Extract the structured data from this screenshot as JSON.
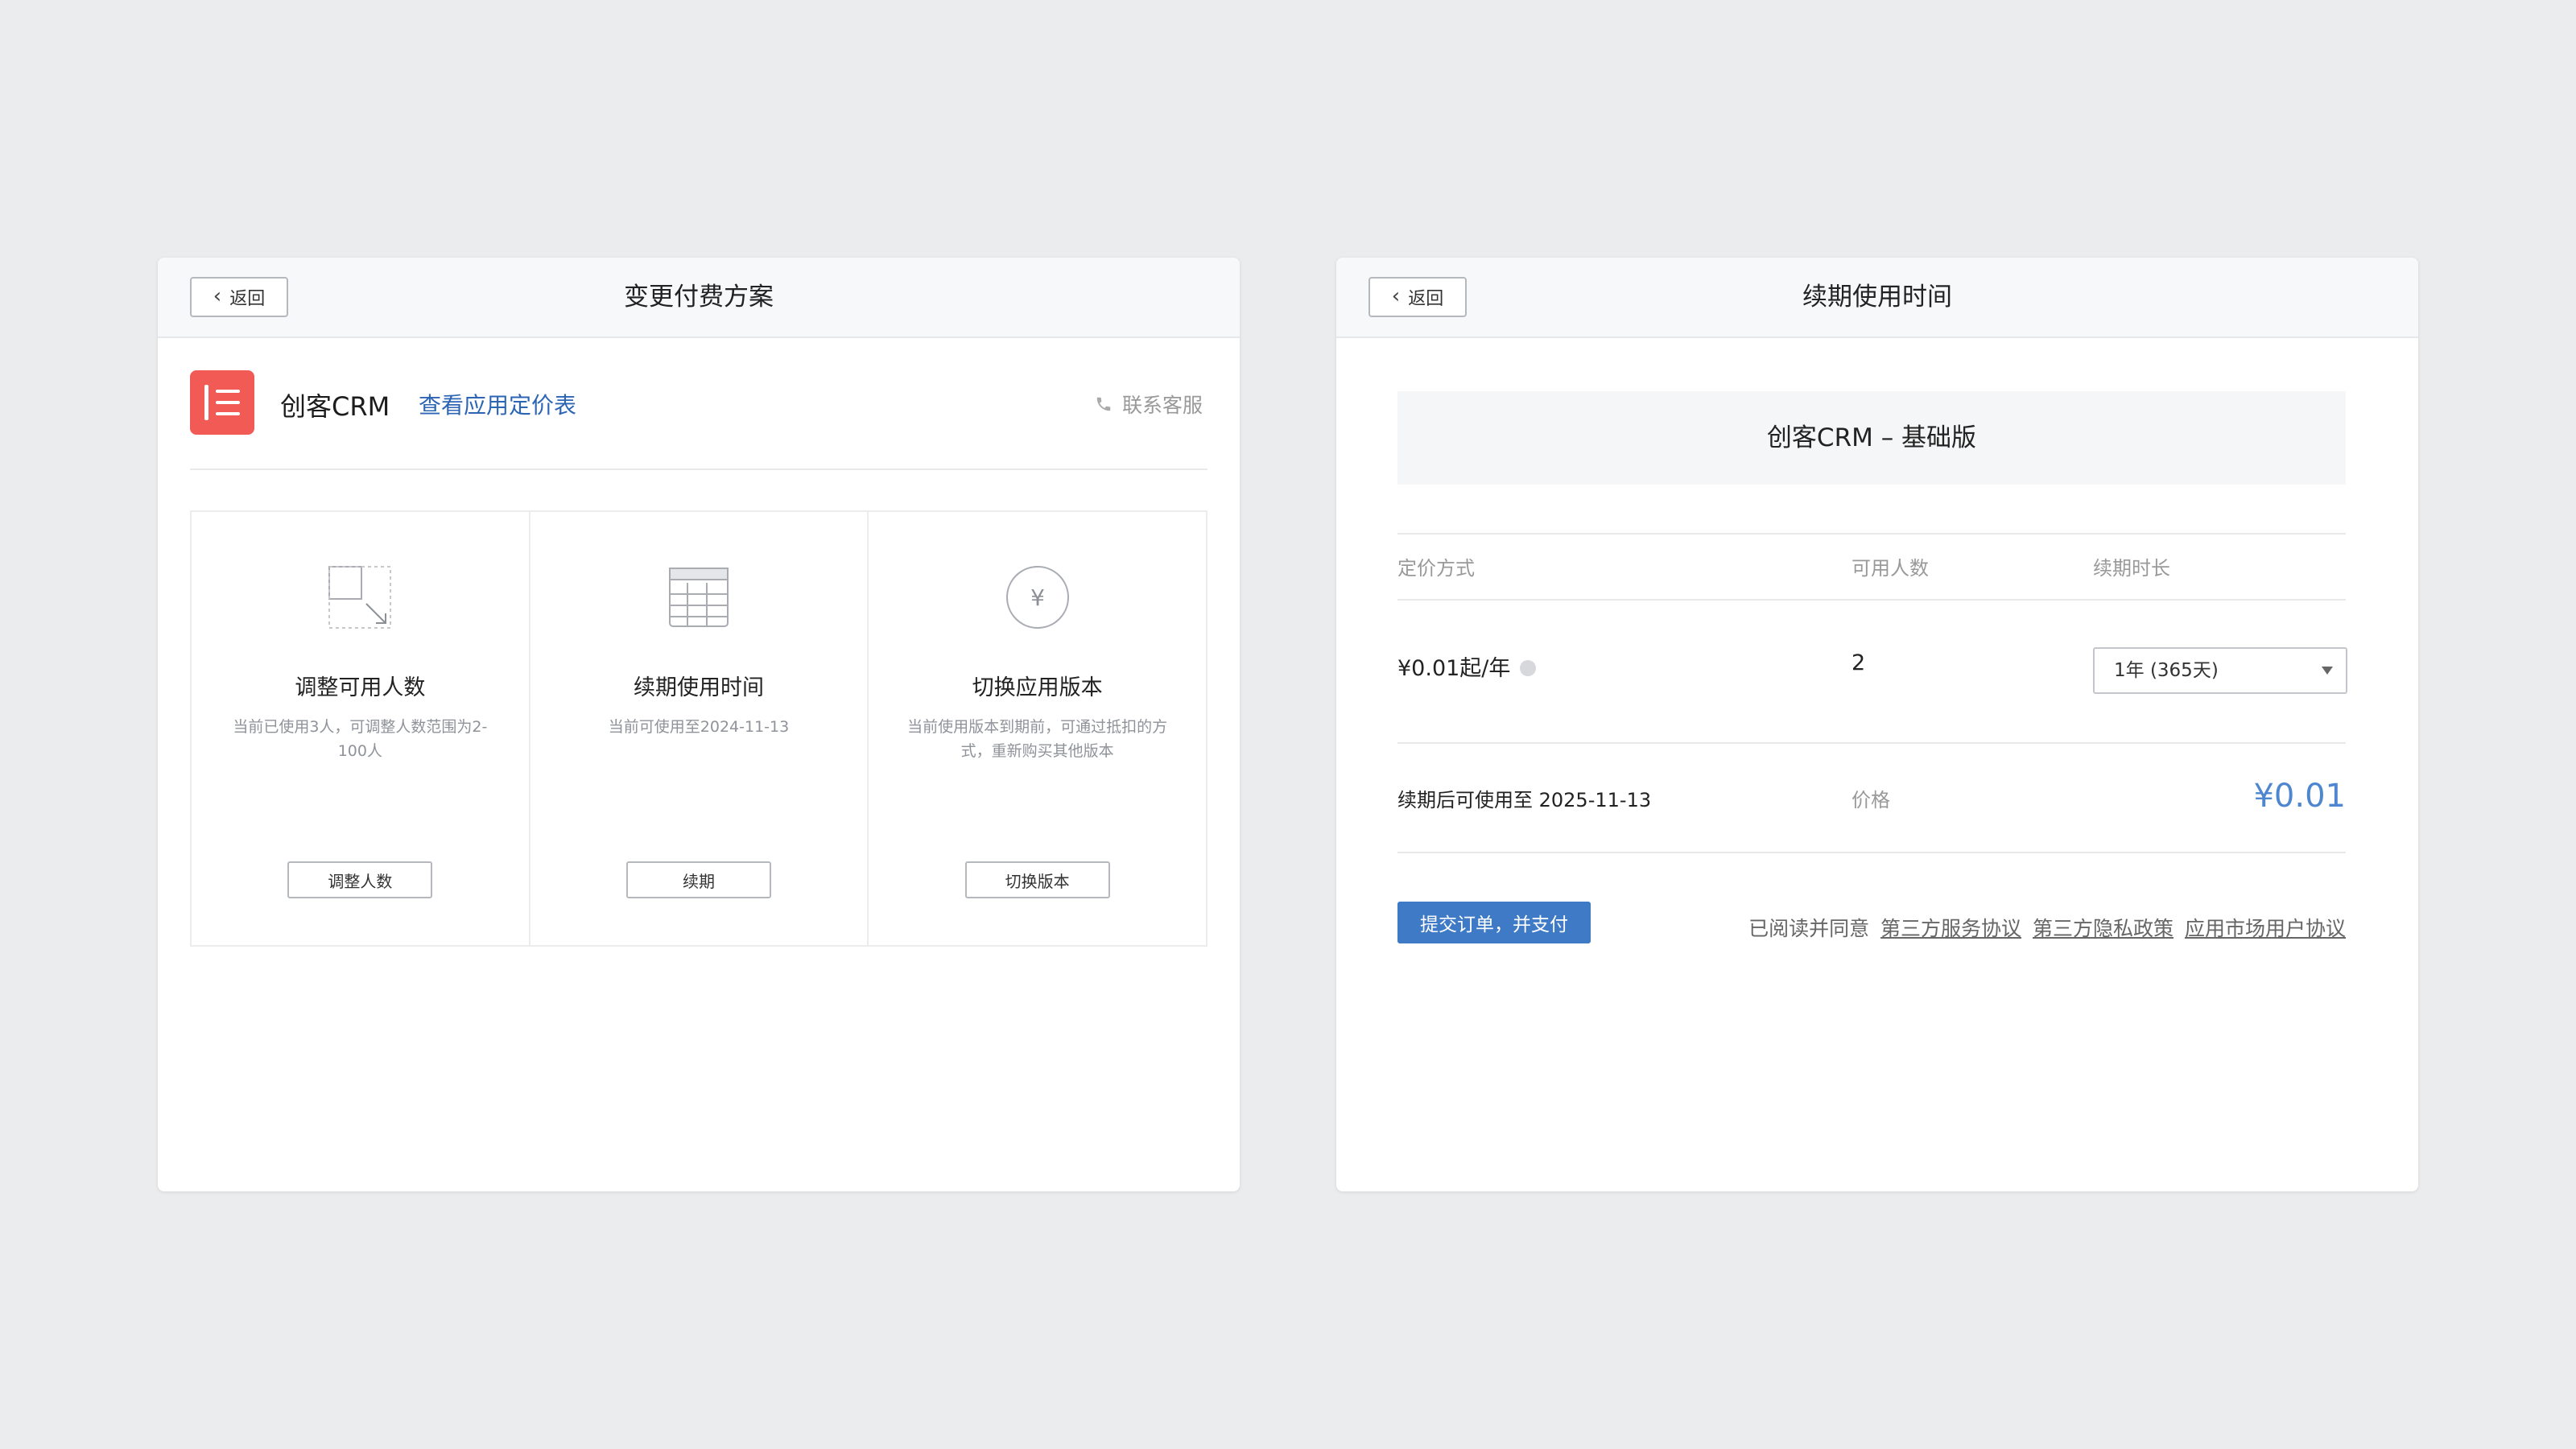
{
  "left_panel": {
    "back_label": "返回",
    "title": "变更付费方案",
    "app_name": "创客CRM",
    "pricing_link": "查看应用定价表",
    "contact_label": "联系客服",
    "cards": [
      {
        "title": "调整可用人数",
        "desc": "当前已使用3人，可调整人数范围为2-100人",
        "button": "调整人数",
        "icon": "resize-users-icon"
      },
      {
        "title": "续期使用时间",
        "desc": "当前可使用至2024-11-13",
        "button": "续期",
        "icon": "calendar-icon"
      },
      {
        "title": "切换应用版本",
        "desc": "当前使用版本到期前，可通过抵扣的方式，重新购买其他版本",
        "button": "切换版本",
        "icon": "yuan-icon"
      }
    ]
  },
  "right_panel": {
    "back_label": "返回",
    "title": "续期使用时间",
    "product_banner": "创客CRM – 基础版",
    "table": {
      "headers": [
        "定价方式",
        "可用人数",
        "续期时长"
      ],
      "price_method": "¥0.01起/年",
      "users": "2",
      "duration_selected": "1年 (365天)"
    },
    "expiry_text": "续期后可使用至 2025-11-13",
    "price_label": "价格",
    "price_value": "¥0.01",
    "submit_label": "提交订单，并支付",
    "agree_prefix": "已阅读并同意",
    "agreements": [
      "第三方服务协议",
      "第三方隐私政策",
      "应用市场用户协议"
    ]
  },
  "colors": {
    "accent": "#3f7ac6",
    "link": "#2d65b5",
    "logo": "#f15a55",
    "price": "#4e86cf"
  }
}
